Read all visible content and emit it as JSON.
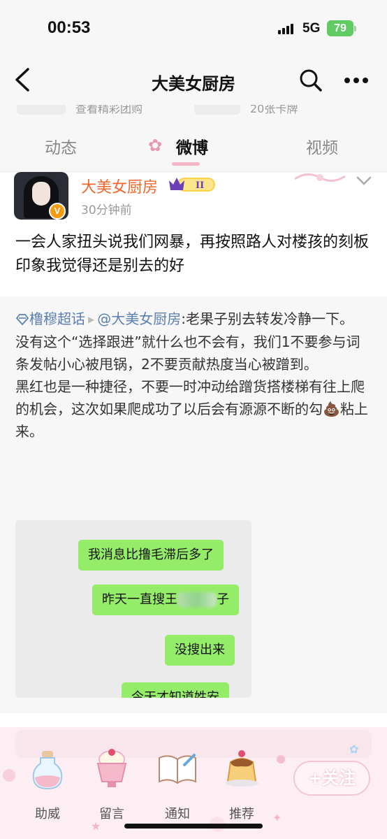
{
  "status_bar": {
    "time": "00:53",
    "network": "5G",
    "battery": "79"
  },
  "nav": {
    "title": "大美女厨房",
    "back_icon": "chevron-left-icon",
    "search_icon": "search-icon",
    "more_icon": "more-dots-icon"
  },
  "peek": {
    "left_text": "查看精彩团购",
    "right_text": "20张卡牌"
  },
  "tabs": [
    {
      "label": "动态",
      "active": false
    },
    {
      "label": "微博",
      "active": true
    },
    {
      "label": "视频",
      "active": false
    }
  ],
  "post": {
    "author": "大美女厨房",
    "level_badge": "II",
    "time": "30分钟前",
    "text": "一会人家扭头说我们网暴，再按照路人对楼孩的刻板印象我觉得还是别去的好"
  },
  "repost": {
    "supertopic": "橹穆超话",
    "mention": "@大美女厨房",
    "text_first": ":老果子别去转发冷静一下。",
    "paragraphs": [
      "没有这个“选择跟进”就什么也不会有，我们1不要参与词条发帖小心被甩锅，2不要贡献热度当心被蹭到。"
    ],
    "para3_before": "黑红也是一种捷径，不要一时冲动给蹭货搭楼梯有往上爬的机会，这次如果爬成功了以后会有源源不断的勾",
    "poop_emoji": "💩",
    "para3_after": "粘上来。"
  },
  "chat_image": {
    "bubbles": [
      {
        "text": "我消息比撸毛滞后多了"
      },
      {
        "text": "昨天一直搜王",
        "suffix": "子"
      },
      {
        "text": "没搜出来"
      },
      {
        "text": "今天才知道姓安"
      }
    ]
  },
  "bottom_bar": {
    "items": [
      {
        "label": "助威",
        "icon": "potion-bottle-icon"
      },
      {
        "label": "留言",
        "icon": "dessert-cup-icon"
      },
      {
        "label": "通知",
        "icon": "open-book-icon"
      },
      {
        "label": "推荐",
        "icon": "pudding-icon"
      }
    ],
    "follow_label": "+关注",
    "colors": {
      "background": "#fdeef3",
      "accent": "#f5b6c8"
    }
  }
}
